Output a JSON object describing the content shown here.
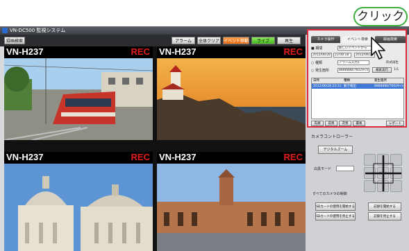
{
  "app": {
    "title": "VN-DC500 監視システム",
    "toolbar": {
      "left_button": "録画検索",
      "buttons": [
        "アラーム",
        "全体クリア",
        "イベント移動",
        "ライブ",
        "再生"
      ]
    }
  },
  "tiles": [
    {
      "camera": "VN-H237",
      "status": "REC"
    },
    {
      "camera": "VN-H237",
      "status": "REC"
    },
    {
      "camera": "VN-H237",
      "status": "REC"
    },
    {
      "camera": "VN-H237",
      "status": "REC"
    }
  ],
  "colors": {
    "rec": "#e21b1b",
    "highlight": "#e0293a",
    "callout_border": "#3dad3d",
    "selected_row": "#3f79d6"
  },
  "callout": {
    "text": "クリック"
  },
  "panel": {
    "tabs": [
      "カメラ操作",
      "イベント検索",
      "録画検索"
    ],
    "row1": {
      "checkbox_label": "期間",
      "field": "新しいイベントから"
    },
    "row2": {
      "from_date": "2012/06/28",
      "from_time": "23:08:18",
      "to_date": "2012/06/28"
    },
    "row3": {
      "checkbox_label": "種類",
      "value": "アラーム入力1",
      "extra": "形式再生"
    },
    "row4": {
      "checkbox_label": "発生箇所",
      "value": "8888888/76029<VN-",
      "button": "検索実行",
      "page": "1/1"
    },
    "table": {
      "headers": [
        "日時",
        "種類",
        "発生箇所"
      ],
      "rows": [
        [
          "2012/06/28 23:11:2...",
          "動き検出",
          "8888888/76029<VN-"
        ]
      ]
    },
    "bottom": [
      "先頭",
      "前頁",
      "次頁",
      "最後",
      "レポート"
    ]
  },
  "controls": {
    "title": "カメラコントローラー",
    "digital_zoom": "デジタルズーム",
    "white_mode": "白黒モード",
    "all_cameras_label": "すべてのカメラの制御",
    "sd_start": "SDカードの使用を開始する",
    "rec_start": "記録を開始する",
    "sd_stop": "SDカードの使用を停止する",
    "rec_stop": "記録を停止する",
    "zoom_center": "ズーム"
  }
}
